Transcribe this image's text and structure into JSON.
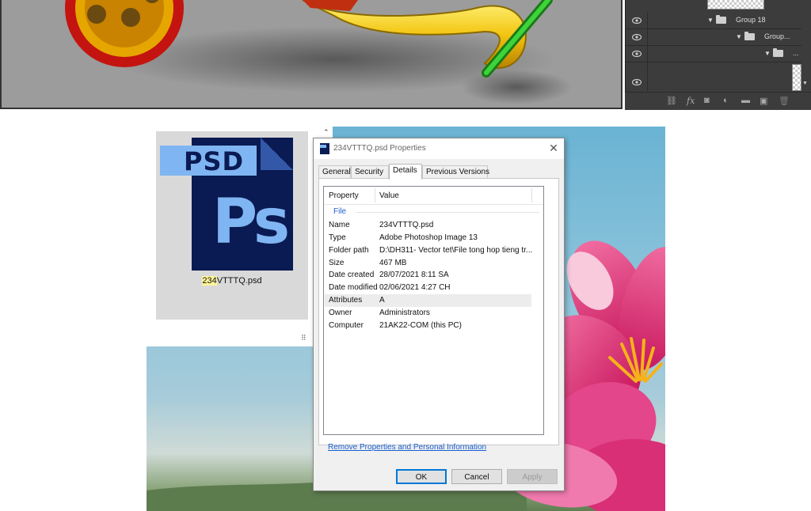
{
  "layers_panel": {
    "rows": [
      {
        "name": "Group 18"
      },
      {
        "name": "Group..."
      },
      {
        "name": "..."
      }
    ],
    "toolbar_icons": [
      "link-icon",
      "fx-icon",
      "mask-icon",
      "adjustment-icon",
      "folder-icon",
      "new-layer-icon",
      "trash-icon"
    ]
  },
  "file_tile": {
    "icon_banner": "PSD",
    "icon_logo": "Ps",
    "name_highlight": "234",
    "name_rest": "VTTTQ.psd"
  },
  "dialog": {
    "title": "234VTTTQ.psd Properties",
    "close_label": "✕",
    "tabs": [
      {
        "label": "General"
      },
      {
        "label": "Security"
      },
      {
        "label": "Details",
        "active": true
      },
      {
        "label": "Previous Versions"
      }
    ],
    "columns": {
      "property": "Property",
      "value": "Value"
    },
    "group": "File",
    "properties": [
      {
        "key": "Name",
        "value": "234VTTTQ.psd"
      },
      {
        "key": "Type",
        "value": "Adobe Photoshop Image 13"
      },
      {
        "key": "Folder path",
        "value": "D:\\DH311- Vector tet\\File tong hop tieng tr..."
      },
      {
        "key": "Size",
        "value": "467 MB"
      },
      {
        "key": "Date created",
        "value": "28/07/2021 8:11 SA"
      },
      {
        "key": "Date modified",
        "value": "02/06/2021 4:27 CH"
      },
      {
        "key": "Attributes",
        "value": "A"
      },
      {
        "key": "Owner",
        "value": "Administrators"
      },
      {
        "key": "Computer",
        "value": "21AK22-COM (this PC)"
      }
    ],
    "remove_link": "Remove Properties and Personal Information",
    "buttons": {
      "ok": "OK",
      "cancel": "Cancel",
      "apply": "Apply"
    }
  },
  "colors": {
    "accent": "#0078d7",
    "link": "#1a5fd1",
    "psd_dark": "#0a1a52",
    "psd_light": "#7fb5f2"
  }
}
